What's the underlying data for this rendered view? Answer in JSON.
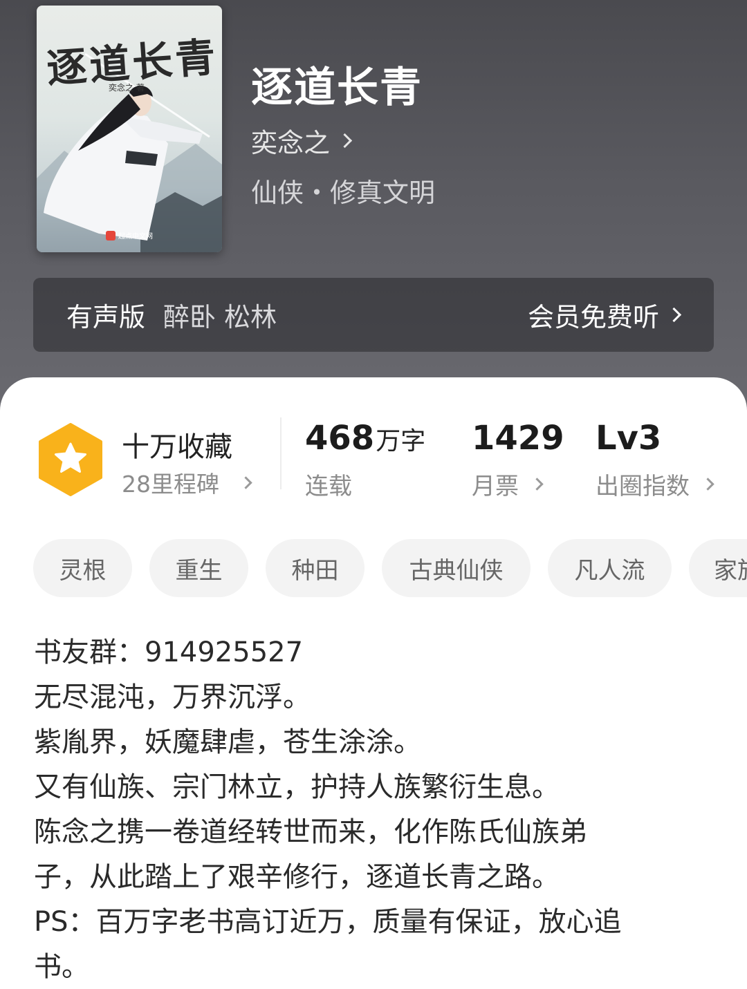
{
  "book": {
    "cover": {
      "title": "逐道长青",
      "author": "奕念之",
      "author_credit": "奕念之 著",
      "publisher": "起点中文网"
    },
    "title": "逐道长青",
    "author": "奕念之",
    "genre": "仙侠・修真文明"
  },
  "audio": {
    "label": "有声版",
    "narrator": "醉卧 松林",
    "action": "会员免费听"
  },
  "stats": {
    "favorites": {
      "title": "十万收藏",
      "subtitle": "28里程碑",
      "badge_color": "#f9b21b"
    },
    "words": {
      "value": "468",
      "unit": "万字",
      "label": "连载"
    },
    "monthly_tickets": {
      "value": "1429",
      "label": "月票"
    },
    "breakout": {
      "value": "Lv3",
      "label": "出圈指数"
    }
  },
  "tags": [
    "灵根",
    "重生",
    "种田",
    "古典仙侠",
    "凡人流",
    "家族"
  ],
  "description": [
    "书友群：914925527",
    "无尽混沌，万界沉浮。",
    "紫胤界，妖魔肆虐，苍生涂涂。",
    "又有仙族、宗门林立，护持人族繁衍生息。",
    "陈念之携一卷道经转世而来，化作陈氏仙族弟",
    "子，从此踏上了艰辛修行，逐道长青之路。",
    "PS：百万字老书高订近万，质量有保证，放心追",
    "书。"
  ]
}
